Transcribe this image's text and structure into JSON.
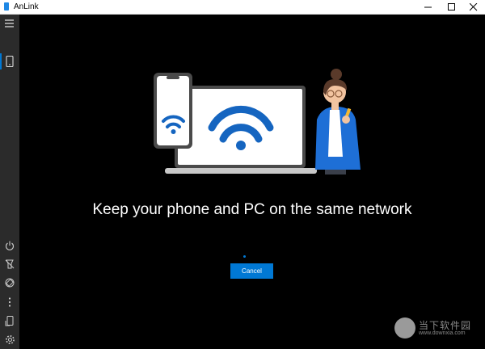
{
  "window": {
    "title": "AnLink",
    "controls": [
      "minimize-icon",
      "maximize-icon",
      "close-icon"
    ]
  },
  "sidebar": {
    "top_items": [
      {
        "icon": "hamburger-menu-icon"
      },
      {
        "icon": "phone-icon",
        "selected": true
      }
    ],
    "bottom_items": [
      {
        "icon": "power-icon"
      },
      {
        "icon": "flashlight-icon"
      },
      {
        "icon": "rotate-icon"
      },
      {
        "icon": "more-vertical-icon"
      },
      {
        "icon": "screen-mirror-icon"
      },
      {
        "icon": "settings-gear-icon"
      }
    ]
  },
  "main": {
    "message": "Keep your phone and PC on the same network",
    "cancel_label": "Cancel"
  },
  "watermark": {
    "text": "当下软件园",
    "url": "www.downxia.com"
  },
  "colors": {
    "accent": "#0078d4",
    "background": "#000000",
    "sidebar": "#2b2b2b"
  }
}
